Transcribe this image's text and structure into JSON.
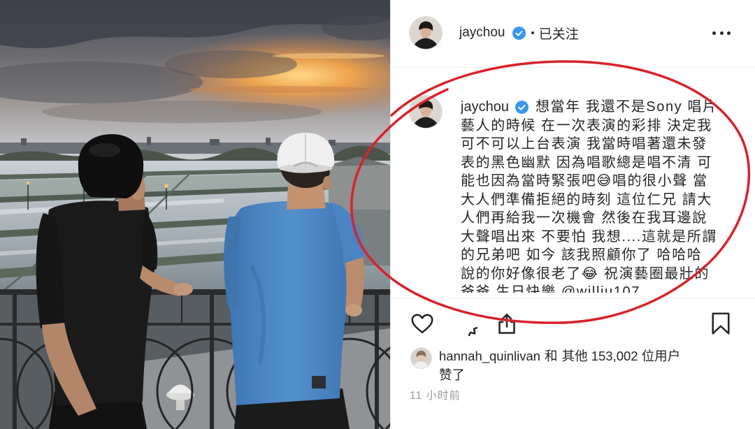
{
  "colors": {
    "text": "#262626",
    "muted": "#999999",
    "divider": "#efefef",
    "verified": "#3897f0",
    "annotation": "#d7232b"
  },
  "header": {
    "username": "jaychou",
    "verified_icon": "verified-badge-icon",
    "separator": "•",
    "follow_status": "已关注",
    "more_icon": "more-options-icon"
  },
  "caption": {
    "username": "jaychou",
    "lines": [
      "想當年 我還不是Sony 唱片",
      "藝人的時候 在一次表演的彩排 決定我",
      "可不可以上台表演 我當時唱著還未發",
      "表的黑色幽默 因為唱歌總是唱不清 可",
      "能也因為當時緊張吧😅唱的很小聲 當",
      "大人們準備拒絕的時刻 這位仁兄 請大",
      "人們再給我一次機會 然後在我耳邊說",
      "大聲唱出來 不要怕 我想....這就是所謂",
      "的兄弟吧 如今 該我照顧你了 哈哈哈",
      "說的你好像很老了😂 祝演藝圈最壯的",
      "爸爸 生日快樂 @williu107"
    ]
  },
  "actions": {
    "like_icon": "heart-icon",
    "comment_icon": "comment-icon",
    "share_icon": "share-icon",
    "save_icon": "bookmark-icon"
  },
  "likes": {
    "user": "hannah_quinlivan",
    "conjunction": "和",
    "others": "其他 153,002 位用户",
    "suffix": "赞了"
  },
  "timestamp": "11 小时前"
}
